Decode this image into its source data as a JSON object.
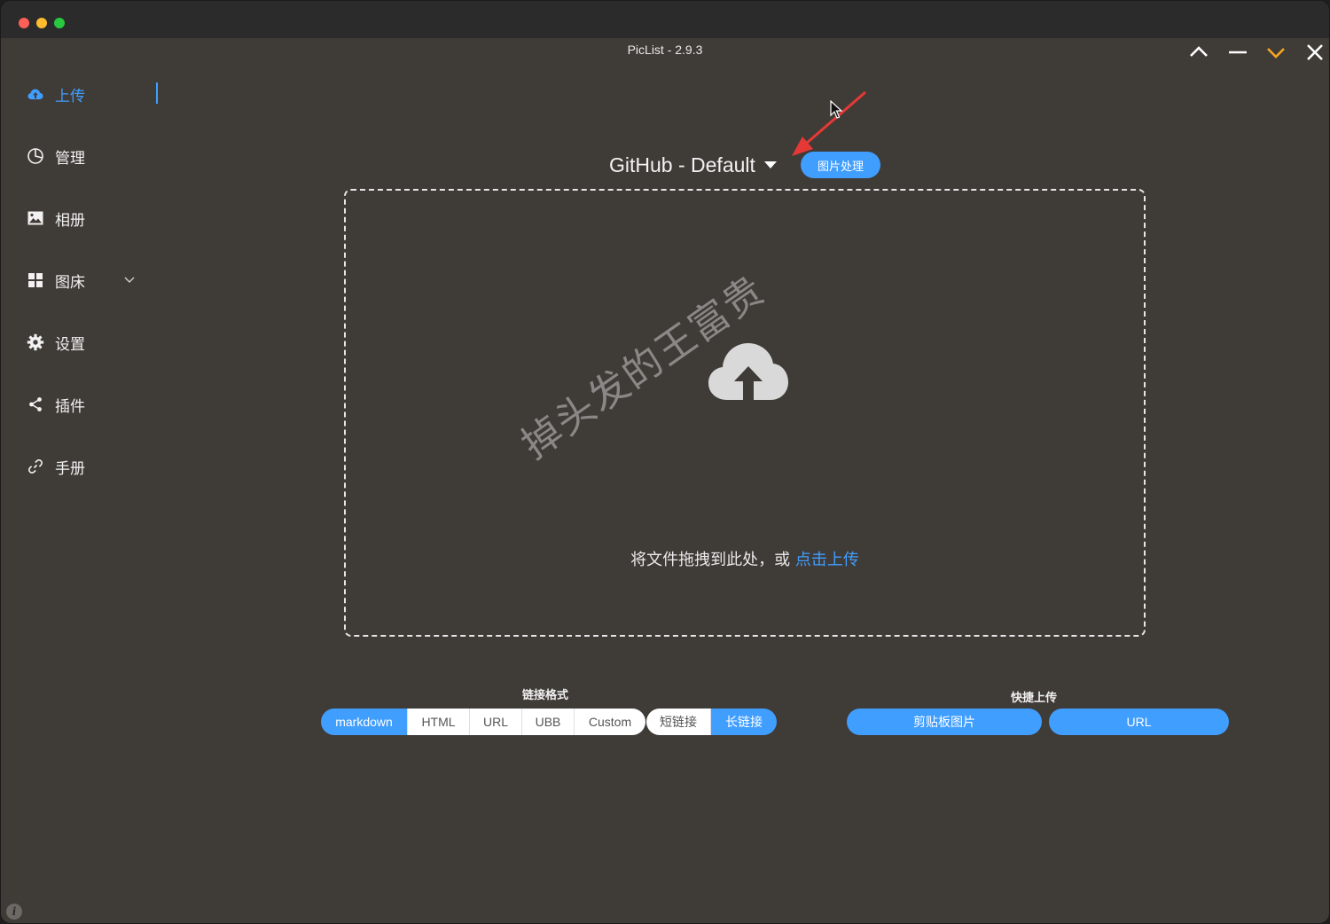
{
  "window": {
    "title": "PicList - 2.9.3"
  },
  "sidebar": {
    "items": [
      {
        "label": "上传",
        "icon": "cloud-upload-icon",
        "active": true
      },
      {
        "label": "管理",
        "icon": "pie-chart-icon"
      },
      {
        "label": "相册",
        "icon": "picture-icon"
      },
      {
        "label": "图床",
        "icon": "grid-icon",
        "expandable": true
      },
      {
        "label": "设置",
        "icon": "gear-icon"
      },
      {
        "label": "插件",
        "icon": "share-icon"
      },
      {
        "label": "手册",
        "icon": "link-icon"
      }
    ]
  },
  "upload": {
    "picbed": "GitHub - Default",
    "image_process_label": "图片处理",
    "drop_text": "将文件拖拽到此处，或 ",
    "drop_link": "点击上传",
    "watermark": "掉头发的王富贵"
  },
  "link_format": {
    "label": "链接格式",
    "options": [
      "markdown",
      "HTML",
      "URL",
      "UBB",
      "Custom"
    ],
    "selected": "markdown",
    "length_options": [
      "短链接",
      "长链接"
    ],
    "length_selected": "长链接"
  },
  "quick_upload": {
    "label": "快捷上传",
    "clipboard_label": "剪贴板图片",
    "url_label": "URL"
  },
  "colors": {
    "accent": "#409eff",
    "background": "#3f3b37",
    "titlebar": "#2b2b2b",
    "annotation_arrow": "#e53935",
    "minimize_highlight": "#f5a623"
  },
  "info": {
    "symbol": "i"
  }
}
